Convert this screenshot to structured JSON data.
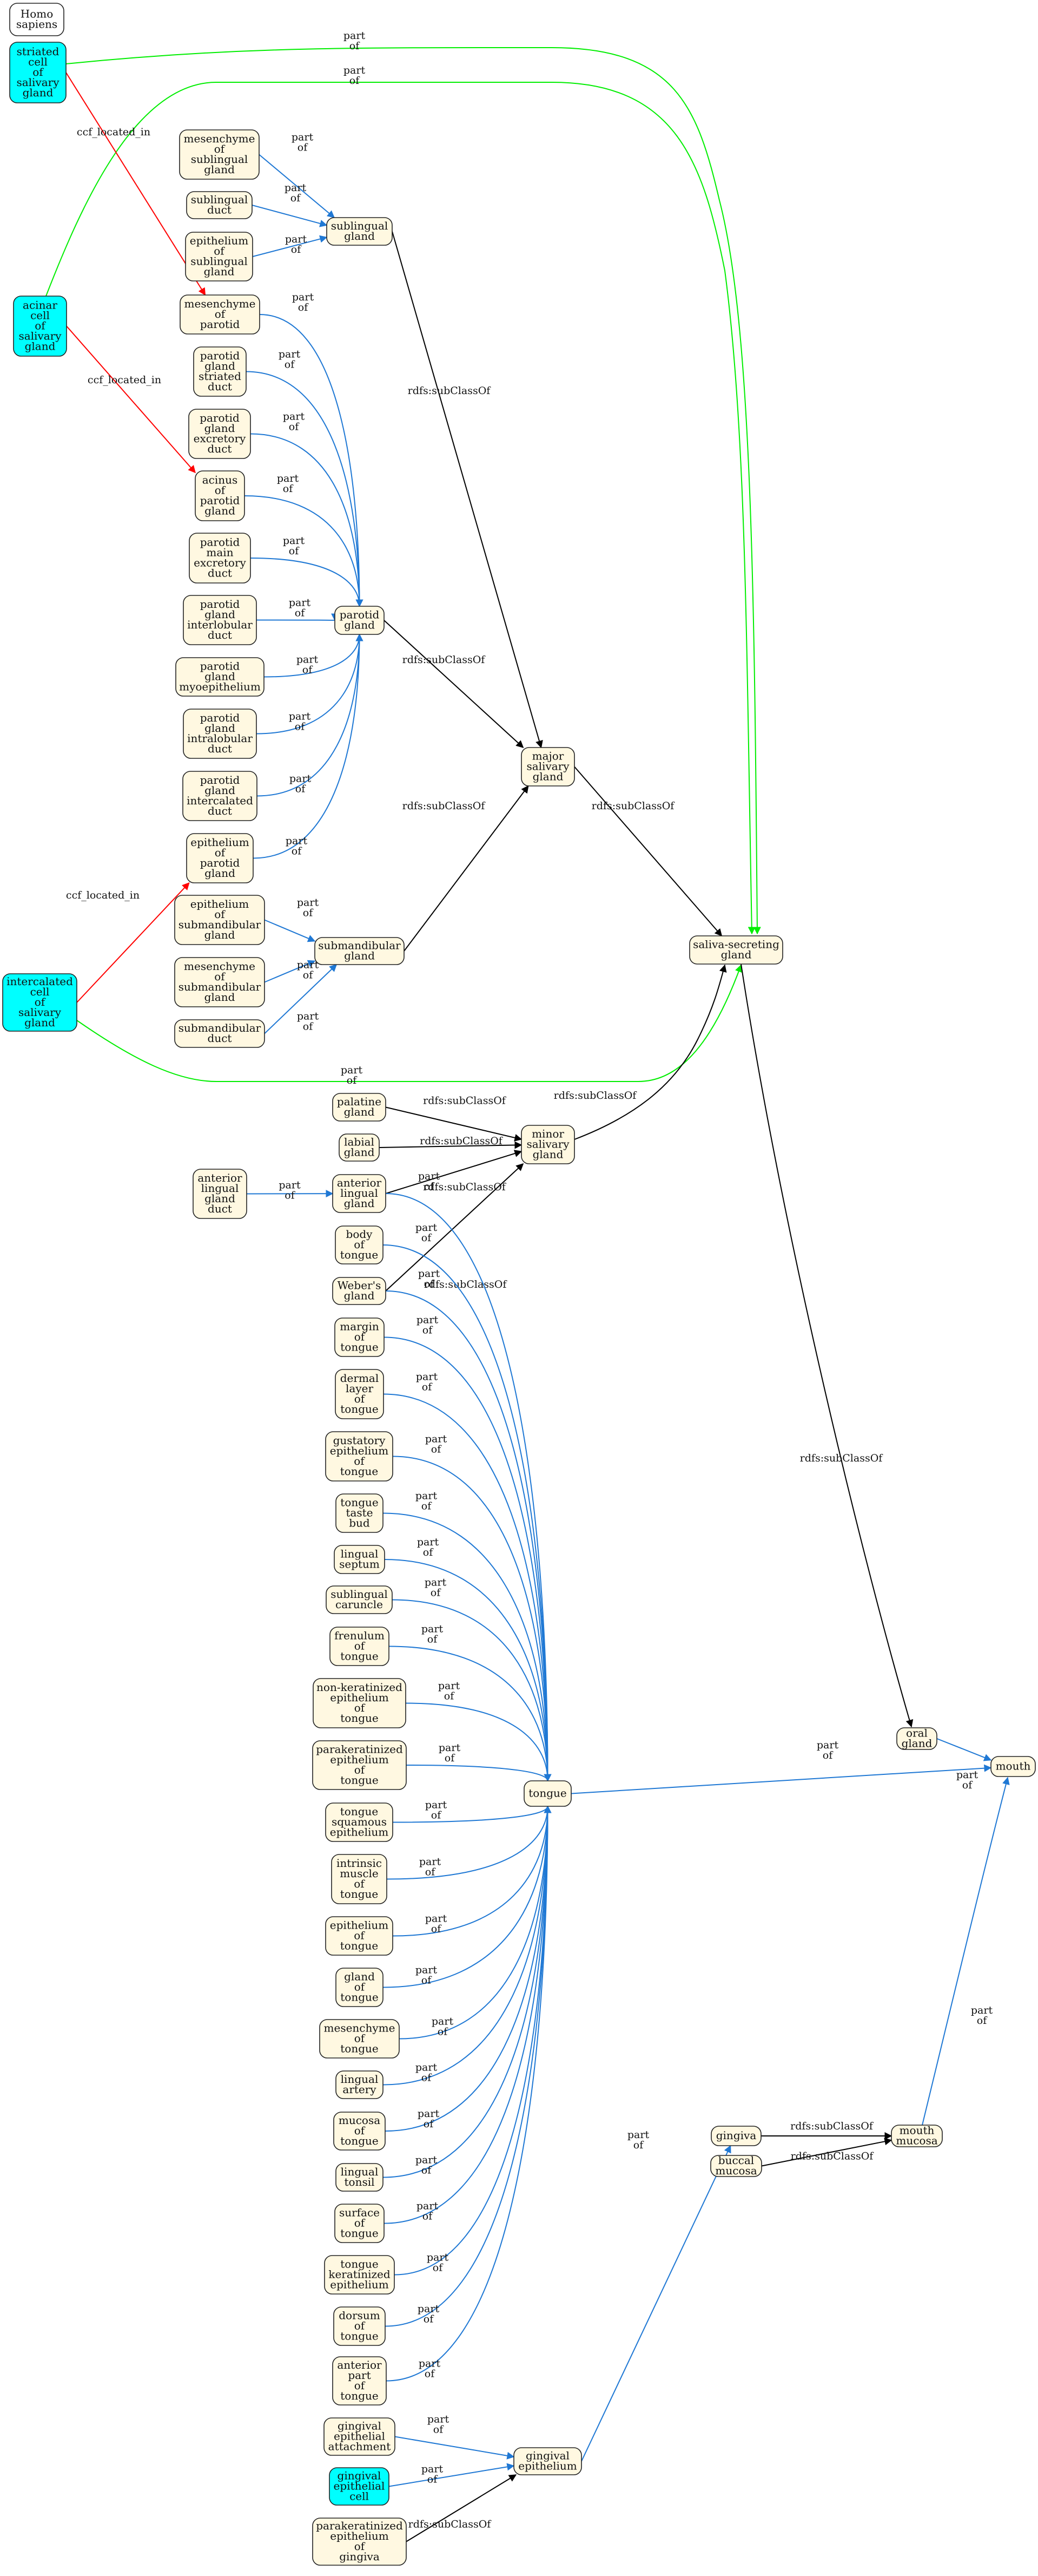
{
  "graph": {
    "colors": {
      "term_fill": "#fff8e1",
      "cell_fill": "#00ffff",
      "taxon_fill": "#ffffff",
      "part_of": "#1f78d4",
      "subclass": "#000000",
      "located_in": "#ff0000",
      "cell_part_of": "#00ee00"
    },
    "nodes": [
      {
        "id": "homo_sapiens",
        "label": "Homo\nsapiens",
        "kind": "taxon"
      },
      {
        "id": "striated_cell",
        "label": "striated\ncell\nof\nsalivary\ngland",
        "kind": "cell"
      },
      {
        "id": "acinar_cell",
        "label": "acinar\ncell\nof\nsalivary\ngland",
        "kind": "cell"
      },
      {
        "id": "intercalated_cell",
        "label": "intercalated\ncell\nof\nsalivary\ngland",
        "kind": "cell"
      },
      {
        "id": "gingival_epithelial_cell",
        "label": "gingival\nepithelial\ncell",
        "kind": "cell"
      },
      {
        "id": "mes_sublingual",
        "label": "mesenchyme\nof\nsublingual\ngland",
        "kind": "term"
      },
      {
        "id": "sublingual_duct",
        "label": "sublingual\nduct",
        "kind": "term"
      },
      {
        "id": "epi_sublingual",
        "label": "epithelium\nof\nsublingual\ngland",
        "kind": "term"
      },
      {
        "id": "sublingual_gland",
        "label": "sublingual\ngland",
        "kind": "term"
      },
      {
        "id": "mes_parotid",
        "label": "mesenchyme\nof\nparotid",
        "kind": "term"
      },
      {
        "id": "parotid_striated",
        "label": "parotid\ngland\nstriated\nduct",
        "kind": "term"
      },
      {
        "id": "parotid_excretory",
        "label": "parotid\ngland\nexcretory\nduct",
        "kind": "term"
      },
      {
        "id": "acinus_parotid",
        "label": "acinus\nof\nparotid\ngland",
        "kind": "term"
      },
      {
        "id": "parotid_main_excretory",
        "label": "parotid\nmain\nexcretory\nduct",
        "kind": "term"
      },
      {
        "id": "parotid_interlobular",
        "label": "parotid\ngland\ninterlobular\nduct",
        "kind": "term"
      },
      {
        "id": "parotid_myoepithelium",
        "label": "parotid\ngland\nmyoepithelium",
        "kind": "term"
      },
      {
        "id": "parotid_intralobular",
        "label": "parotid\ngland\nintralobular\nduct",
        "kind": "term"
      },
      {
        "id": "parotid_intercalated",
        "label": "parotid\ngland\nintercalated\nduct",
        "kind": "term"
      },
      {
        "id": "epi_parotid",
        "label": "epithelium\nof\nparotid\ngland",
        "kind": "term"
      },
      {
        "id": "parotid_gland",
        "label": "parotid\ngland",
        "kind": "term"
      },
      {
        "id": "epi_submand",
        "label": "epithelium\nof\nsubmandibular\ngland",
        "kind": "term"
      },
      {
        "id": "mes_submand",
        "label": "mesenchyme\nof\nsubmandibular\ngland",
        "kind": "term"
      },
      {
        "id": "submand_duct",
        "label": "submandibular\nduct",
        "kind": "term"
      },
      {
        "id": "submand_gland",
        "label": "submandibular\ngland",
        "kind": "term"
      },
      {
        "id": "major_salivary",
        "label": "major\nsalivary\ngland",
        "kind": "term"
      },
      {
        "id": "saliva_secreting",
        "label": "saliva-secreting\ngland",
        "kind": "term"
      },
      {
        "id": "palatine_gland",
        "label": "palatine\ngland",
        "kind": "term"
      },
      {
        "id": "labial_gland",
        "label": "labial\ngland",
        "kind": "term"
      },
      {
        "id": "ant_lingual_duct",
        "label": "anterior\nlingual\ngland\nduct",
        "kind": "term"
      },
      {
        "id": "ant_lingual_gland",
        "label": "anterior\nlingual\ngland",
        "kind": "term"
      },
      {
        "id": "minor_salivary",
        "label": "minor\nsalivary\ngland",
        "kind": "term"
      },
      {
        "id": "body_tongue",
        "label": "body\nof\ntongue",
        "kind": "term"
      },
      {
        "id": "webers_gland",
        "label": "Weber's\ngland",
        "kind": "term"
      },
      {
        "id": "margin_tongue",
        "label": "margin\nof\ntongue",
        "kind": "term"
      },
      {
        "id": "dermal_layer",
        "label": "dermal\nlayer\nof\ntongue",
        "kind": "term"
      },
      {
        "id": "gustatory_epi",
        "label": "gustatory\nepithelium\nof\ntongue",
        "kind": "term"
      },
      {
        "id": "taste_bud",
        "label": "tongue\ntaste\nbud",
        "kind": "term"
      },
      {
        "id": "lingual_septum",
        "label": "lingual\nseptum",
        "kind": "term"
      },
      {
        "id": "sublingual_caruncle",
        "label": "sublingual\ncaruncle",
        "kind": "term"
      },
      {
        "id": "frenulum",
        "label": "frenulum\nof\ntongue",
        "kind": "term"
      },
      {
        "id": "nonkeratinized",
        "label": "non-keratinized\nepithelium\nof\ntongue",
        "kind": "term"
      },
      {
        "id": "parakeratinized_tongue",
        "label": "parakeratinized\nepithelium\nof\ntongue",
        "kind": "term"
      },
      {
        "id": "tongue_squamous",
        "label": "tongue\nsquamous\nepithelium",
        "kind": "term"
      },
      {
        "id": "intrinsic_muscle",
        "label": "intrinsic\nmuscle\nof\ntongue",
        "kind": "term"
      },
      {
        "id": "epi_tongue",
        "label": "epithelium\nof\ntongue",
        "kind": "term"
      },
      {
        "id": "gland_tongue",
        "label": "gland\nof\ntongue",
        "kind": "term"
      },
      {
        "id": "mes_tongue",
        "label": "mesenchyme\nof\ntongue",
        "kind": "term"
      },
      {
        "id": "lingual_artery",
        "label": "lingual\nartery",
        "kind": "term"
      },
      {
        "id": "mucosa_tongue",
        "label": "mucosa\nof\ntongue",
        "kind": "term"
      },
      {
        "id": "lingual_tonsil",
        "label": "lingual\ntonsil",
        "kind": "term"
      },
      {
        "id": "surface_tongue",
        "label": "surface\nof\ntongue",
        "kind": "term"
      },
      {
        "id": "tongue_keratinized",
        "label": "tongue\nkeratinized\nepithelium",
        "kind": "term"
      },
      {
        "id": "dorsum_tongue",
        "label": "dorsum\nof\ntongue",
        "kind": "term"
      },
      {
        "id": "anterior_part_tongue",
        "label": "anterior\npart\nof\ntongue",
        "kind": "term"
      },
      {
        "id": "tongue",
        "label": "tongue",
        "kind": "term"
      },
      {
        "id": "gingival_attachment",
        "label": "gingival\nepithelial\nattachment",
        "kind": "term"
      },
      {
        "id": "parakeratinized_gingiva",
        "label": "parakeratinized\nepithelium\nof\ngingiva",
        "kind": "term"
      },
      {
        "id": "gingival_epithelium",
        "label": "gingival\nepithelium",
        "kind": "term"
      },
      {
        "id": "oral_gland",
        "label": "oral\ngland",
        "kind": "term"
      },
      {
        "id": "mouth",
        "label": "mouth",
        "kind": "term"
      },
      {
        "id": "gingiva",
        "label": "gingiva",
        "kind": "term"
      },
      {
        "id": "buccal_mucosa",
        "label": "buccal\nmucosa",
        "kind": "term"
      },
      {
        "id": "mouth_mucosa",
        "label": "mouth\nmucosa",
        "kind": "term"
      }
    ],
    "edges": [
      {
        "from": "striated_cell",
        "to": "saliva_secreting",
        "label": "part\nof",
        "type": "cell_part_of"
      },
      {
        "from": "acinar_cell",
        "to": "saliva_secreting",
        "label": "part\nof",
        "type": "cell_part_of"
      },
      {
        "from": "intercalated_cell",
        "to": "saliva_secreting",
        "label": "part\nof",
        "type": "cell_part_of"
      },
      {
        "from": "striated_cell",
        "to": "mes_parotid",
        "label": "ccf_located_in",
        "type": "located_in"
      },
      {
        "from": "acinar_cell",
        "to": "acinus_parotid",
        "label": "ccf_located_in",
        "type": "located_in"
      },
      {
        "from": "intercalated_cell",
        "to": "epi_parotid",
        "label": "ccf_located_in",
        "type": "located_in"
      },
      {
        "from": "mes_sublingual",
        "to": "sublingual_gland",
        "label": "part\nof",
        "type": "part_of"
      },
      {
        "from": "sublingual_duct",
        "to": "sublingual_gland",
        "label": "part\nof",
        "type": "part_of"
      },
      {
        "from": "epi_sublingual",
        "to": "sublingual_gland",
        "label": "part\nof",
        "type": "part_of"
      },
      {
        "from": "sublingual_gland",
        "to": "major_salivary",
        "label": "rdfs:subClassOf",
        "type": "subclass"
      },
      {
        "from": "mes_parotid",
        "to": "parotid_gland",
        "label": "part\nof",
        "type": "part_of"
      },
      {
        "from": "parotid_striated",
        "to": "parotid_gland",
        "label": "part\nof",
        "type": "part_of"
      },
      {
        "from": "parotid_excretory",
        "to": "parotid_gland",
        "label": "part\nof",
        "type": "part_of"
      },
      {
        "from": "acinus_parotid",
        "to": "parotid_gland",
        "label": "part\nof",
        "type": "part_of"
      },
      {
        "from": "parotid_main_excretory",
        "to": "parotid_gland",
        "label": "part\nof",
        "type": "part_of"
      },
      {
        "from": "parotid_interlobular",
        "to": "parotid_gland",
        "label": "part\nof",
        "type": "part_of"
      },
      {
        "from": "parotid_myoepithelium",
        "to": "parotid_gland",
        "label": "part\nof",
        "type": "part_of"
      },
      {
        "from": "parotid_intralobular",
        "to": "parotid_gland",
        "label": "part\nof",
        "type": "part_of"
      },
      {
        "from": "parotid_intercalated",
        "to": "parotid_gland",
        "label": "part\nof",
        "type": "part_of"
      },
      {
        "from": "epi_parotid",
        "to": "parotid_gland",
        "label": "part\nof",
        "type": "part_of"
      },
      {
        "from": "parotid_gland",
        "to": "major_salivary",
        "label": "rdfs:subClassOf",
        "type": "subclass"
      },
      {
        "from": "epi_submand",
        "to": "submand_gland",
        "label": "part\nof",
        "type": "part_of"
      },
      {
        "from": "mes_submand",
        "to": "submand_gland",
        "label": "part\nof",
        "type": "part_of"
      },
      {
        "from": "submand_duct",
        "to": "submand_gland",
        "label": "part\nof",
        "type": "part_of"
      },
      {
        "from": "submand_gland",
        "to": "major_salivary",
        "label": "rdfs:subClassOf",
        "type": "subclass"
      },
      {
        "from": "major_salivary",
        "to": "saliva_secreting",
        "label": "rdfs:subClassOf",
        "type": "subclass"
      },
      {
        "from": "minor_salivary",
        "to": "saliva_secreting",
        "label": "rdfs:subClassOf",
        "type": "subclass"
      },
      {
        "from": "saliva_secreting",
        "to": "oral_gland",
        "label": "rdfs:subClassOf",
        "type": "subclass"
      },
      {
        "from": "palatine_gland",
        "to": "minor_salivary",
        "label": "rdfs:subClassOf",
        "type": "subclass"
      },
      {
        "from": "labial_gland",
        "to": "minor_salivary",
        "label": "rdfs:subClassOf",
        "type": "subclass"
      },
      {
        "from": "ant_lingual_gland",
        "to": "minor_salivary",
        "label": "rdfs:subClassOf",
        "type": "subclass"
      },
      {
        "from": "webers_gland",
        "to": "minor_salivary",
        "label": "rdfs:subClassOf",
        "type": "subclass"
      },
      {
        "from": "ant_lingual_duct",
        "to": "ant_lingual_gland",
        "label": "part\nof",
        "type": "part_of"
      },
      {
        "from": "ant_lingual_gland",
        "to": "tongue",
        "label": "part\nof",
        "type": "part_of"
      },
      {
        "from": "body_tongue",
        "to": "tongue",
        "label": "part\nof",
        "type": "part_of"
      },
      {
        "from": "webers_gland",
        "to": "tongue",
        "label": "part\nof",
        "type": "part_of"
      },
      {
        "from": "margin_tongue",
        "to": "tongue",
        "label": "part\nof",
        "type": "part_of"
      },
      {
        "from": "dermal_layer",
        "to": "tongue",
        "label": "part\nof",
        "type": "part_of"
      },
      {
        "from": "gustatory_epi",
        "to": "tongue",
        "label": "part\nof",
        "type": "part_of"
      },
      {
        "from": "taste_bud",
        "to": "tongue",
        "label": "part\nof",
        "type": "part_of"
      },
      {
        "from": "lingual_septum",
        "to": "tongue",
        "label": "part\nof",
        "type": "part_of"
      },
      {
        "from": "sublingual_caruncle",
        "to": "tongue",
        "label": "part\nof",
        "type": "part_of"
      },
      {
        "from": "frenulum",
        "to": "tongue",
        "label": "part\nof",
        "type": "part_of"
      },
      {
        "from": "nonkeratinized",
        "to": "tongue",
        "label": "part\nof",
        "type": "part_of"
      },
      {
        "from": "parakeratinized_tongue",
        "to": "tongue",
        "label": "part\nof",
        "type": "part_of"
      },
      {
        "from": "tongue_squamous",
        "to": "tongue",
        "label": "part\nof",
        "type": "part_of"
      },
      {
        "from": "intrinsic_muscle",
        "to": "tongue",
        "label": "part\nof",
        "type": "part_of"
      },
      {
        "from": "epi_tongue",
        "to": "tongue",
        "label": "part\nof",
        "type": "part_of"
      },
      {
        "from": "gland_tongue",
        "to": "tongue",
        "label": "part\nof",
        "type": "part_of"
      },
      {
        "from": "mes_tongue",
        "to": "tongue",
        "label": "part\nof",
        "type": "part_of"
      },
      {
        "from": "lingual_artery",
        "to": "tongue",
        "label": "part\nof",
        "type": "part_of"
      },
      {
        "from": "mucosa_tongue",
        "to": "tongue",
        "label": "part\nof",
        "type": "part_of"
      },
      {
        "from": "lingual_tonsil",
        "to": "tongue",
        "label": "part\nof",
        "type": "part_of"
      },
      {
        "from": "surface_tongue",
        "to": "tongue",
        "label": "part\nof",
        "type": "part_of"
      },
      {
        "from": "tongue_keratinized",
        "to": "tongue",
        "label": "part\nof",
        "type": "part_of"
      },
      {
        "from": "dorsum_tongue",
        "to": "tongue",
        "label": "part\nof",
        "type": "part_of"
      },
      {
        "from": "anterior_part_tongue",
        "to": "tongue",
        "label": "part\nof",
        "type": "part_of"
      },
      {
        "from": "tongue",
        "to": "mouth",
        "label": "part\nof",
        "type": "part_of"
      },
      {
        "from": "oral_gland",
        "to": "mouth",
        "label": "part\nof",
        "type": "part_of"
      },
      {
        "from": "mouth_mucosa",
        "to": "mouth",
        "label": "part\nof",
        "type": "part_of"
      },
      {
        "from": "gingival_attachment",
        "to": "gingival_epithelium",
        "label": "part\nof",
        "type": "part_of"
      },
      {
        "from": "gingival_epithelial_cell",
        "to": "gingival_epithelium",
        "label": "part\nof",
        "type": "part_of"
      },
      {
        "from": "parakeratinized_gingiva",
        "to": "gingival_epithelium",
        "label": "rdfs:subClassOf",
        "type": "subclass"
      },
      {
        "from": "gingival_epithelium",
        "to": "gingiva",
        "label": "part\nof",
        "type": "part_of"
      },
      {
        "from": "gingiva",
        "to": "mouth_mucosa",
        "label": "rdfs:subClassOf",
        "type": "subclass"
      },
      {
        "from": "buccal_mucosa",
        "to": "mouth_mucosa",
        "label": "rdfs:subClassOf",
        "type": "subclass"
      }
    ]
  }
}
